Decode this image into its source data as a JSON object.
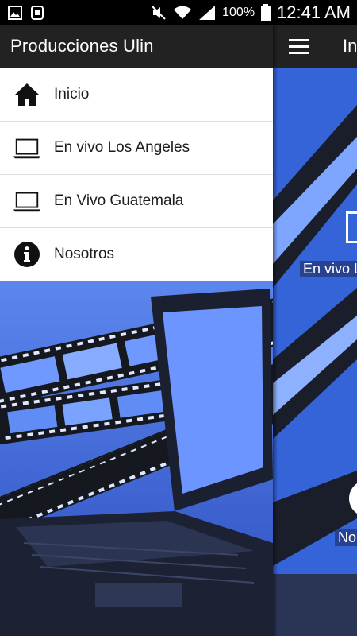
{
  "status_bar": {
    "battery_text": "100%",
    "time": "12:41 AM",
    "icons": [
      "image-icon",
      "notification-app-icon",
      "mute-icon",
      "wifi-icon",
      "signal-icon",
      "battery-icon"
    ]
  },
  "drawer": {
    "title": "Producciones Ulin",
    "items": [
      {
        "label": "Inicio",
        "icon": "home-icon"
      },
      {
        "label": "En vivo Los Angeles",
        "icon": "laptop-icon"
      },
      {
        "label": "En Vivo Guatemala",
        "icon": "laptop-icon"
      },
      {
        "label": "Nosotros",
        "icon": "info-icon"
      }
    ]
  },
  "underlay": {
    "title": "In",
    "label_1": "En vivo L",
    "label_2": "No",
    "menu_icon": "hamburger-icon"
  },
  "colors": {
    "app_bar": "#222222",
    "background_blue": "#3a64d8",
    "status_bar": "#000000"
  }
}
